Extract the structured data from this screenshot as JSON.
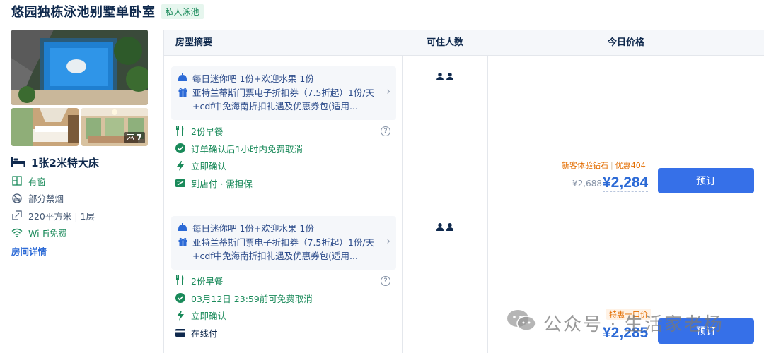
{
  "header": {
    "title": "悠园独栋泳池别墅单卧室",
    "tag": "私人泳池"
  },
  "photos": {
    "count": "7"
  },
  "room": {
    "bed": "1张2米特大床",
    "facilities": [
      {
        "icon": "window-icon",
        "label": "有窗",
        "highlight": true
      },
      {
        "icon": "no-smoking-icon",
        "label": "部分禁烟",
        "highlight": false
      },
      {
        "icon": "area-icon",
        "label": "220平方米 | 1层",
        "highlight": false
      },
      {
        "icon": "wifi-icon",
        "label": "Wi-Fi免费",
        "highlight": true
      }
    ],
    "details_link": "房间详情"
  },
  "table": {
    "headers": {
      "summary": "房型摘要",
      "guests": "可住人数",
      "price": "今日价格"
    }
  },
  "offers": [
    {
      "package_line1": "每日迷你吧 1份+欢迎水果 1份",
      "package_line2": "亚特兰蒂斯门票电子折扣券（7.5折起）1份/天+cdf中免海南折扣礼遇及优惠券包(适用...",
      "breakfast": "2份早餐",
      "cancel": "订单确认后1小时内免费取消",
      "confirm": "立即确认",
      "payment": "到店付 · 需担保",
      "payment_icon": "pay-at-hotel-icon",
      "promo_label": "新客体验钻石",
      "promo_discount": "优惠404",
      "old_price": "¥2,688",
      "price": "¥2,284",
      "book": "预订"
    },
    {
      "package_line1": "每日迷你吧 1份+欢迎水果 1份",
      "package_line2": "亚特兰蒂斯门票电子折扣券（7.5折起）1份/天+cdf中免海南折扣礼遇及优惠券包(适用...",
      "breakfast": "2份早餐",
      "cancel": "03月12日 23:59前可免费取消",
      "confirm": "立即确认",
      "payment": "在线付",
      "payment_icon": "card-icon",
      "promo_tag": "特惠一口价",
      "price": "¥2,285",
      "book": "预订"
    }
  ],
  "watermark": "公众号 · 生活家老杨",
  "colors": {
    "accent": "#3670e8",
    "green": "#1a8a5a",
    "orange": "#e36d00",
    "text": "#0f294d"
  }
}
